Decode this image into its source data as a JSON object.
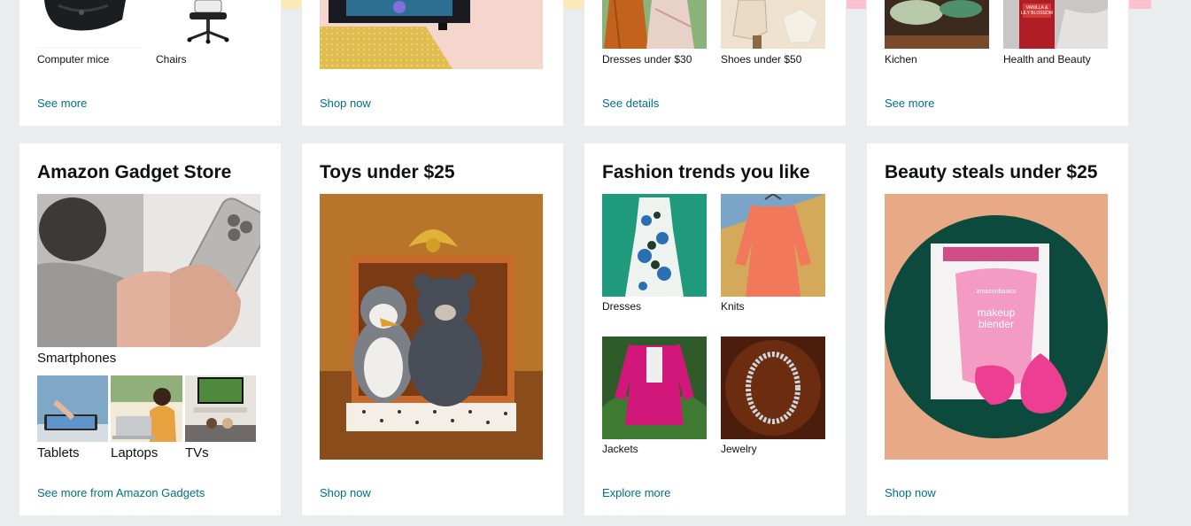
{
  "colors": {
    "page_bg": "#eaeded",
    "card_bg": "#ffffff",
    "link": "#007185",
    "strip_yellow": "#fce9b7",
    "strip_pink": "#ffc0cf"
  },
  "top_row": [
    {
      "id": "computer-accessories",
      "items": [
        {
          "label": "Computer mice",
          "icon": "computer-mouse-image"
        },
        {
          "label": "Chairs",
          "icon": "office-chair-image"
        }
      ],
      "link": "See more"
    },
    {
      "id": "gaming-pc",
      "items": [
        {
          "label": "",
          "icon": "gaming-pc-image"
        }
      ],
      "link": "Shop now"
    },
    {
      "id": "fashion-deals",
      "items": [
        {
          "label": "Dresses under $30",
          "icon": "dresses-image"
        },
        {
          "label": "Shoes under $50",
          "icon": "boots-image"
        }
      ],
      "link": "See details"
    },
    {
      "id": "home-beauty",
      "items": [
        {
          "label": "Kichen",
          "icon": "kitchen-image"
        },
        {
          "label": "Health and Beauty",
          "icon": "beauty-bottle-image"
        }
      ],
      "link": "See more"
    }
  ],
  "gadget_card": {
    "title": "Amazon Gadget Store",
    "main_label": "Smartphones",
    "sub_items": [
      {
        "label": "Tablets"
      },
      {
        "label": "Laptops"
      },
      {
        "label": "TVs"
      }
    ],
    "link": "See more from Amazon Gadgets"
  },
  "toys_card": {
    "title": "Toys under $25",
    "link": "Shop now"
  },
  "fashion_card": {
    "title": "Fashion trends you like",
    "items": [
      {
        "label": "Dresses"
      },
      {
        "label": "Knits"
      },
      {
        "label": "Jackets"
      },
      {
        "label": "Jewelry"
      }
    ],
    "link": "Explore more"
  },
  "beauty_card": {
    "title": "Beauty steals under $25",
    "product_brand": "amazonbasics",
    "product_name_line1": "makeup",
    "product_name_line2": "blender",
    "link": "Shop now"
  }
}
